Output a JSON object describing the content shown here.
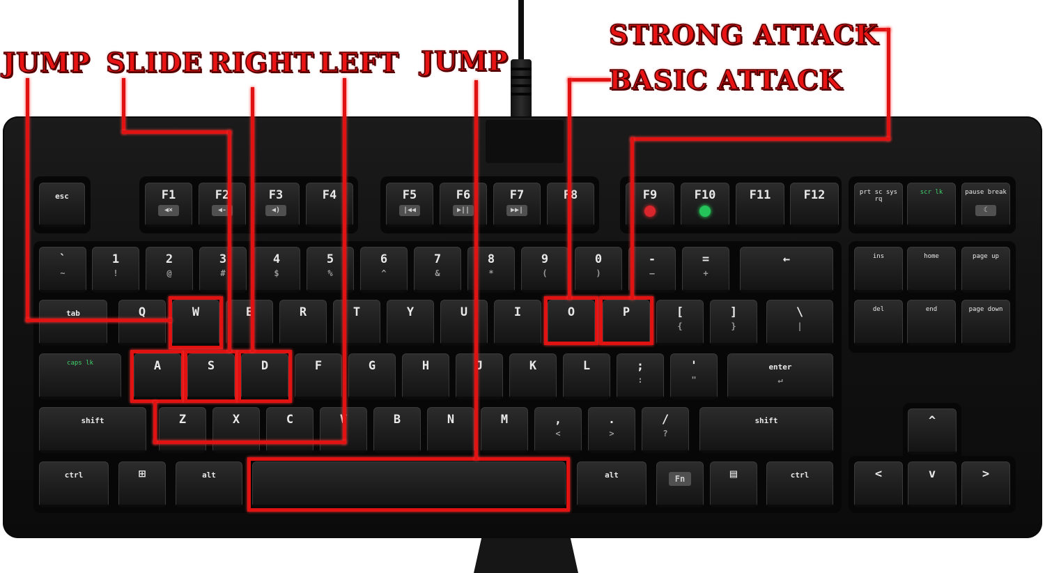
{
  "labels": {
    "jump_left": "JUMP",
    "slide": "SLIDE",
    "right": "RIGHT",
    "left": "LEFT",
    "jump_right": "JUMP",
    "strong_attack": "STRONG ATTACK",
    "basic_attack": "BASIC ATTACK"
  },
  "keys": {
    "esc": "esc",
    "f1": "F1",
    "f2": "F2",
    "f3": "F3",
    "f4": "F4",
    "f5": "F5",
    "f6": "F6",
    "f7": "F7",
    "f8": "F8",
    "f9": "F9",
    "f10": "F10",
    "f11": "F11",
    "f12": "F12",
    "prtsc": "prt sc sys rq",
    "scrlk": "scr lk",
    "pause": "pause break",
    "grave": "`",
    "grave_sec": "~",
    "n1": "1",
    "n1s": "!",
    "n2": "2",
    "n2s": "@",
    "n3": "3",
    "n3s": "#",
    "n4": "4",
    "n4s": "$",
    "n5": "5",
    "n5s": "%",
    "n6": "6",
    "n6s": "^",
    "n7": "7",
    "n7s": "&",
    "n8": "8",
    "n8s": "*",
    "n9": "9",
    "n9s": "(",
    "n0": "0",
    "n0s": ")",
    "minus": "-",
    "minus_s": "—",
    "equal": "=",
    "equal_s": "+",
    "backspace": "←",
    "ins": "ins",
    "home": "home",
    "pgup": "page up",
    "tab": "tab",
    "q": "Q",
    "w": "W",
    "e": "E",
    "r": "R",
    "t": "T",
    "y": "Y",
    "u": "U",
    "i": "I",
    "o": "O",
    "p": "P",
    "lbr": "[",
    "lbr_s": "{",
    "rbr": "]",
    "rbr_s": "}",
    "bslash": "\\",
    "bslash_s": "|",
    "del": "del",
    "end": "end",
    "pgdn": "page down",
    "caps": "caps lk",
    "a": "A",
    "s": "S",
    "d": "D",
    "f": "F",
    "g": "G",
    "h": "H",
    "j": "J",
    "k": "K",
    "l": "L",
    "semi": ";",
    "semi_s": ":",
    "quote": "'",
    "quote_s": "\"",
    "enter": "enter",
    "lshift": "shift",
    "z": "Z",
    "x": "X",
    "c": "C",
    "v": "V",
    "b": "B",
    "n": "N",
    "m": "M",
    "comma": ",",
    "comma_s": "<",
    "period": ".",
    "period_s": ">",
    "slash": "/",
    "slash_s": "?",
    "rshift": "shift",
    "lctrl": "ctrl",
    "lalt": "alt",
    "space": "",
    "ralt": "alt",
    "fn": "Fn",
    "rctrl": "ctrl",
    "up": "^",
    "left": "<",
    "down": "v",
    "right": ">"
  },
  "media_glyphs": {
    "f1": "◀×",
    "f2": "◀-",
    "f3": "◀)",
    "f5": "|◀◀",
    "f6": "▶||",
    "f7": "▶▶|"
  },
  "colors": {
    "highlight": "#e11212",
    "keyboard": "#121212",
    "led_red": "#d8262c",
    "led_green": "#25c45a"
  }
}
